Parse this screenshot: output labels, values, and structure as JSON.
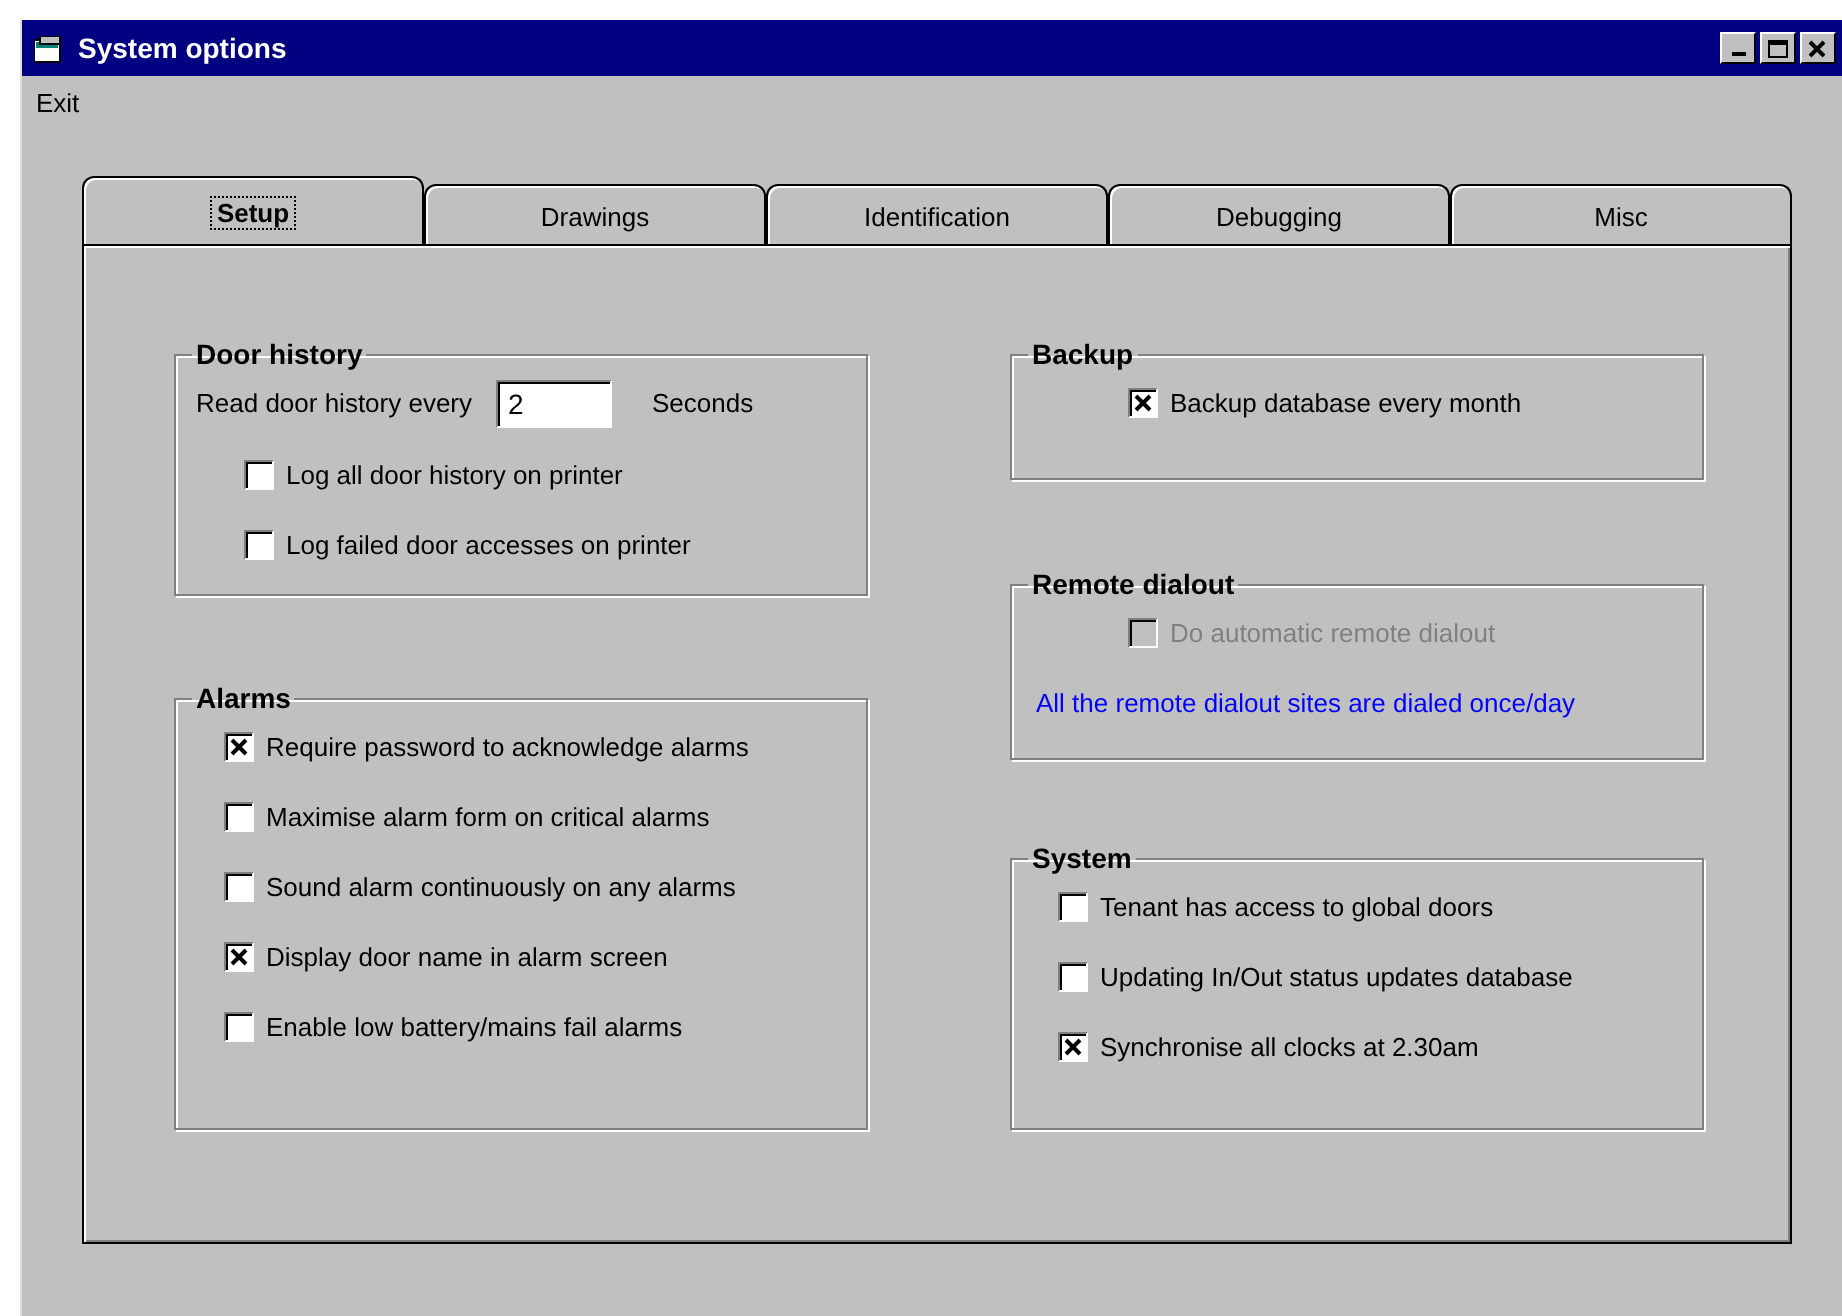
{
  "window": {
    "title": "System options"
  },
  "menu": [
    {
      "label": "Exit"
    }
  ],
  "tabs": [
    {
      "label": "Setup",
      "selected": true
    },
    {
      "label": "Drawings",
      "selected": false
    },
    {
      "label": "Identification",
      "selected": false
    },
    {
      "label": "Debugging",
      "selected": false
    },
    {
      "label": "Misc",
      "selected": false
    }
  ],
  "columns": [
    {
      "groups": [
        {
          "title": "Door history",
          "rows": [
            {
              "kind": "field",
              "label": "Read door history every",
              "value": "2",
              "unit": "Seconds"
            },
            {
              "kind": "checkbox",
              "label": "Log all door history on printer",
              "checked": false,
              "disabled": false
            },
            {
              "kind": "checkbox",
              "label": "Log failed door accesses on printer",
              "checked": false,
              "disabled": false
            }
          ]
        },
        {
          "title": "Alarms",
          "rows": [
            {
              "kind": "checkbox",
              "label": "Require password to acknowledge alarms",
              "checked": true,
              "disabled": false
            },
            {
              "kind": "checkbox",
              "label": "Maximise alarm form on critical alarms",
              "checked": false,
              "disabled": false
            },
            {
              "kind": "checkbox",
              "label": "Sound alarm continuously on any alarms",
              "checked": false,
              "disabled": false
            },
            {
              "kind": "checkbox",
              "label": "Display door name in alarm screen",
              "checked": true,
              "disabled": false
            },
            {
              "kind": "checkbox",
              "label": "Enable low battery/mains fail alarms",
              "checked": false,
              "disabled": false
            }
          ]
        }
      ]
    },
    {
      "groups": [
        {
          "title": "Backup",
          "rows": [
            {
              "kind": "checkbox",
              "label": "Backup database every month",
              "checked": true,
              "disabled": false
            }
          ]
        },
        {
          "title": "Remote dialout",
          "rows": [
            {
              "kind": "checkbox",
              "label": "Do automatic remote dialout",
              "checked": false,
              "disabled": true
            },
            {
              "kind": "note",
              "label": "All the remote dialout sites are dialed once/day",
              "color": "#0000ff"
            }
          ]
        },
        {
          "title": "System",
          "rows": [
            {
              "kind": "checkbox",
              "label": "Tenant has access to global doors",
              "checked": false,
              "disabled": false
            },
            {
              "kind": "checkbox",
              "label": "Updating In/Out status updates database",
              "checked": false,
              "disabled": false
            },
            {
              "kind": "checkbox",
              "label": "Synchronise all clocks at 2.30am",
              "checked": true,
              "disabled": false
            }
          ]
        }
      ]
    }
  ]
}
